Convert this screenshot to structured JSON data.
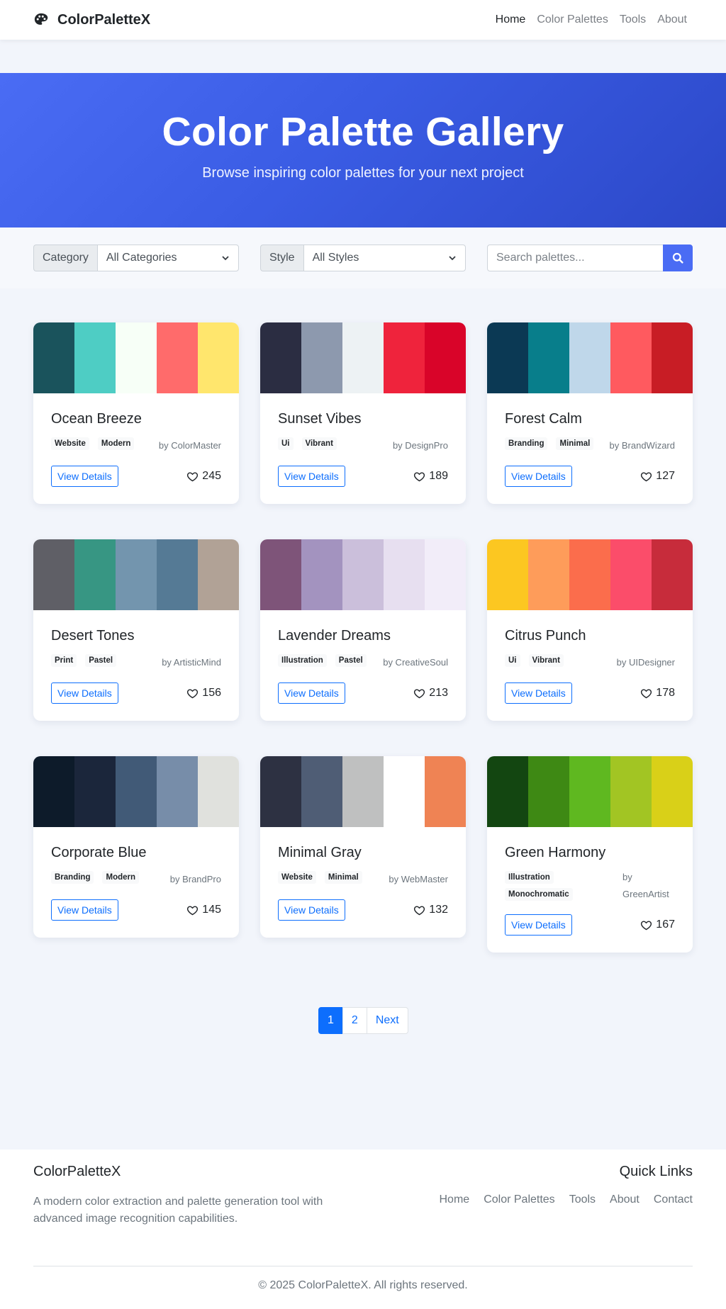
{
  "nav": {
    "brand": "ColorPaletteX",
    "links": [
      "Home",
      "Color Palettes",
      "Tools",
      "About"
    ],
    "active_index": 0
  },
  "hero": {
    "title": "Color Palette Gallery",
    "subtitle": "Browse inspiring color palettes for your next project"
  },
  "filters": {
    "category_label": "Category",
    "category_value": "All Categories",
    "style_label": "Style",
    "style_value": "All Styles",
    "search_placeholder": "Search palettes..."
  },
  "colors": {
    "accent": "#4a6cf4",
    "link": "#0d6efd",
    "hero_gradient": [
      "#4a6cf4",
      "#2c48c8"
    ]
  },
  "palettes": [
    {
      "name": "Ocean Breeze",
      "tags": [
        "Website",
        "Modern"
      ],
      "author": "by ColorMaster",
      "likes": "245",
      "colors": [
        "#1a535c",
        "#4ecdc4",
        "#f7fff7",
        "#ff6b6b",
        "#ffe66d"
      ]
    },
    {
      "name": "Sunset Vibes",
      "tags": [
        "Ui",
        "Vibrant"
      ],
      "author": "by DesignPro",
      "likes": "189",
      "colors": [
        "#2b2d42",
        "#8d99ae",
        "#edf2f4",
        "#ef233c",
        "#d90429"
      ]
    },
    {
      "name": "Forest Calm",
      "tags": [
        "Branding",
        "Minimal"
      ],
      "author": "by BrandWizard",
      "likes": "127",
      "colors": [
        "#0b3954",
        "#087e8b",
        "#bfd7ea",
        "#ff5a5f",
        "#c81d25"
      ]
    },
    {
      "name": "Desert Tones",
      "tags": [
        "Print",
        "Pastel"
      ],
      "author": "by ArtisticMind",
      "likes": "156",
      "colors": [
        "#5f5f66",
        "#379683",
        "#7395ae",
        "#557a95",
        "#b1a296"
      ]
    },
    {
      "name": "Lavender Dreams",
      "tags": [
        "Illustration",
        "Pastel"
      ],
      "author": "by CreativeSoul",
      "likes": "213",
      "colors": [
        "#7e5479",
        "#a393bf",
        "#cbbfdb",
        "#e7dff0",
        "#f2edf9"
      ]
    },
    {
      "name": "Citrus Punch",
      "tags": [
        "Ui",
        "Vibrant"
      ],
      "author": "by UIDesigner",
      "likes": "178",
      "colors": [
        "#fcc721",
        "#fe9c5a",
        "#fb6d4c",
        "#fb4d6a",
        "#c72c3b"
      ]
    },
    {
      "name": "Corporate Blue",
      "tags": [
        "Branding",
        "Modern"
      ],
      "author": "by BrandPro",
      "likes": "145",
      "colors": [
        "#0d1b2a",
        "#1b263b",
        "#415a77",
        "#778da9",
        "#e0e1dd"
      ]
    },
    {
      "name": "Minimal Gray",
      "tags": [
        "Website",
        "Minimal"
      ],
      "author": "by WebMaster",
      "likes": "132",
      "colors": [
        "#2d3142",
        "#4f5d75",
        "#bfc0c0",
        "#ffffff",
        "#ef8354"
      ]
    },
    {
      "name": "Green Harmony",
      "tags": [
        "Illustration",
        "Monochromatic"
      ],
      "author": "by GreenArtist",
      "likes": "167",
      "colors": [
        "#134611",
        "#3e8914",
        "#5fb820",
        "#a2c523",
        "#d9d018"
      ]
    }
  ],
  "card": {
    "view_label": "View Details"
  },
  "pagination": {
    "pages": [
      "1",
      "2"
    ],
    "next_label": "Next",
    "current": "1"
  },
  "footer": {
    "brand": "ColorPaletteX",
    "description": "A modern color extraction and palette generation tool with advanced image recognition capabilities.",
    "quick_links_title": "Quick Links",
    "links": [
      "Home",
      "Color Palettes",
      "Tools",
      "About",
      "Contact"
    ],
    "copyright": "© 2025 ColorPaletteX. All rights reserved."
  }
}
